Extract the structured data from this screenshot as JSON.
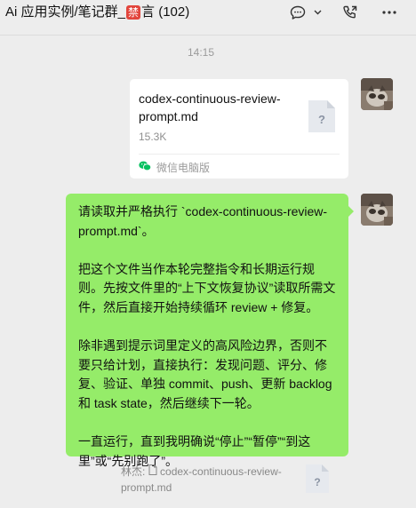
{
  "window": {
    "title_prefix": "Ai 应用实例/笔记群_",
    "ban_char": "禁",
    "title_suffix": "言 (102)"
  },
  "toolbar": {
    "icons": [
      "chat-bubble-icon",
      "chevron-down-icon",
      "phone-call-icon",
      "more-icon"
    ]
  },
  "chat": {
    "timestamp": "14:15",
    "file_message": {
      "file_name": "codex-continuous-review-prompt.md",
      "file_size": "15.3K",
      "file_icon_glyph": "?",
      "source": "微信电脑版"
    },
    "text_message": {
      "paragraphs": [
        "请读取并严格执行 `codex-continuous-review-prompt.md`。",
        "把这个文件当作本轮完整指令和长期运行规则。先按文件里的“上下文恢复协议”读取所需文件，然后直接开始持续循环 review + 修复。",
        "除非遇到提示词里定义的高风险边界，否则不要只给计划，直接执行：发现问题、评分、修复、验证、单独 commit、push、更新 backlog 和 task state，然后继续下一轮。",
        "一直运行，直到我明确说“停止”“暂停”“到这里”或“先别跑了”。"
      ],
      "bubble_color": "#95ec69"
    },
    "quote": {
      "sender": "林杰:",
      "file_name": "codex-continuous-review-prompt.md",
      "file_icon_glyph": "?"
    }
  },
  "colors": {
    "background": "#ededed",
    "ban_badge": "#e2453c",
    "wechat_green": "#07c160"
  }
}
